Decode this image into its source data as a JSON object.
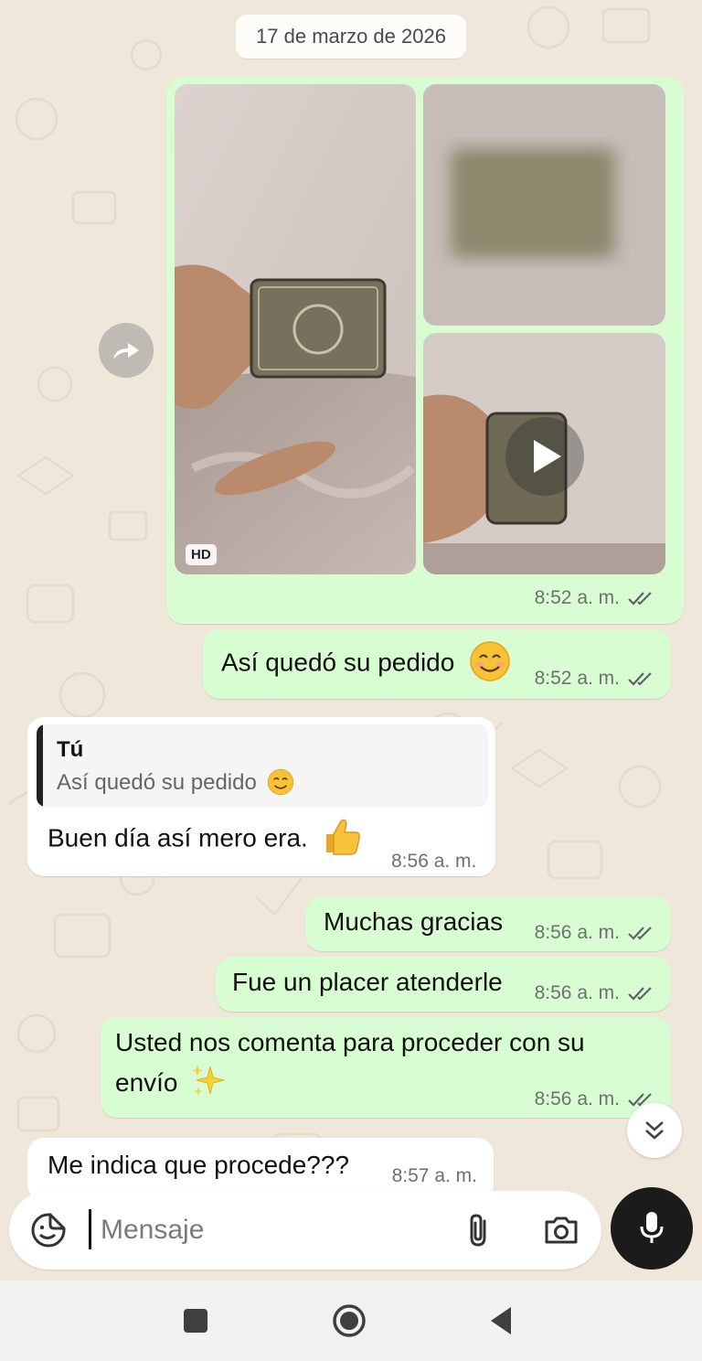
{
  "date_separator": "17 de marzo de 2026",
  "messages": [
    {
      "type": "media-album",
      "time": "8:52 a. m.",
      "hd_label": "HD",
      "status": "read"
    },
    {
      "type": "text-out",
      "text": "Así quedó su pedido",
      "emoji": "smiling-face-emoji",
      "time": "8:52 a. m.",
      "status": "read"
    },
    {
      "type": "reply-in",
      "quoted_author": "Tú",
      "quoted_text": "Así quedó su pedido",
      "text": "Buen día así mero era.",
      "emoji": "thumbs-up-emoji",
      "time": "8:56 a. m."
    },
    {
      "type": "text-out",
      "text": "Muchas gracias",
      "time": "8:56 a. m.",
      "status": "read"
    },
    {
      "type": "text-out",
      "text": "Fue un placer atenderle",
      "time": "8:56 a. m.",
      "status": "read"
    },
    {
      "type": "text-out",
      "line1": "Usted nos comenta para proceder con su",
      "line2": "envío",
      "emoji": "sparkles-emoji",
      "time": "8:56 a. m.",
      "status": "read"
    },
    {
      "type": "text-in",
      "text": "Me indica que procede???",
      "time": "8:57 a. m."
    }
  ],
  "composer": {
    "placeholder": "Mensaje"
  },
  "colors": {
    "outgoing": "#d9fdd3",
    "incoming": "#ffffff",
    "read_ticks": "#5f6368",
    "mic_button": "#1b1b1b"
  },
  "icons": [
    "forward-icon",
    "play-icon",
    "read-receipt-icon",
    "scroll-down-icon",
    "sticker-icon",
    "attach-icon",
    "camera-icon",
    "mic-icon",
    "nav-recents-icon",
    "nav-home-icon",
    "nav-back-icon"
  ]
}
